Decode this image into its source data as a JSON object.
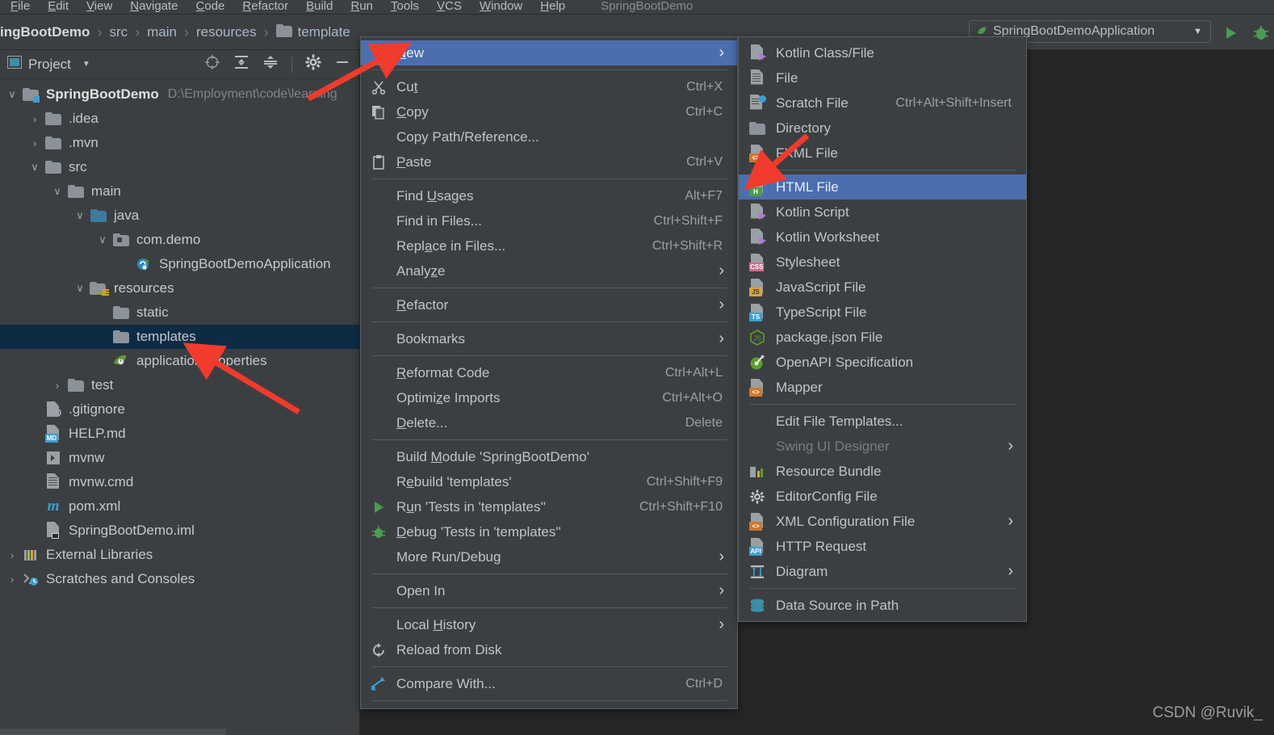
{
  "menubar": {
    "items": [
      "File",
      "Edit",
      "View",
      "Navigate",
      "Code",
      "Refactor",
      "Build",
      "Run",
      "Tools",
      "VCS",
      "Window",
      "Help"
    ],
    "project_name": "SpringBootDemo"
  },
  "toolbar": {
    "run_config_label": "SpringBootDemoApplication",
    "caret": "▼",
    "run_icon": "run-icon",
    "debug_icon": "debug-icon"
  },
  "breadcrumb": {
    "crumbs": [
      "ingBootDemo",
      "src",
      "main",
      "resources",
      "template"
    ],
    "separator": "›"
  },
  "toolwindow": {
    "title": "Project",
    "caret": "▼",
    "actions": [
      "locate-icon",
      "expand-all-icon",
      "collapse-all-icon",
      "gear-icon",
      "hide-icon"
    ]
  },
  "tree": [
    {
      "indent": 0,
      "arrow": "∨",
      "icon": "project-folder-icon",
      "label": "SpringBootDemo",
      "bold": true,
      "subtle": "D:\\Employment\\code\\learning",
      "selected": false
    },
    {
      "indent": 1,
      "arrow": "›",
      "icon": "folder-icon",
      "label": ".idea",
      "bold": false,
      "subtle": "",
      "selected": false
    },
    {
      "indent": 1,
      "arrow": "›",
      "icon": "folder-icon",
      "label": ".mvn",
      "bold": false,
      "subtle": "",
      "selected": false
    },
    {
      "indent": 1,
      "arrow": "∨",
      "icon": "folder-icon",
      "label": "src",
      "bold": false,
      "subtle": "",
      "selected": false
    },
    {
      "indent": 2,
      "arrow": "∨",
      "icon": "folder-icon",
      "label": "main",
      "bold": false,
      "subtle": "",
      "selected": false
    },
    {
      "indent": 3,
      "arrow": "∨",
      "icon": "source-folder-icon",
      "label": "java",
      "bold": false,
      "subtle": "",
      "selected": false
    },
    {
      "indent": 4,
      "arrow": "∨",
      "icon": "package-icon",
      "label": "com.demo",
      "bold": false,
      "subtle": "",
      "selected": false
    },
    {
      "indent": 5,
      "arrow": "",
      "icon": "spring-class-icon",
      "label": "SpringBootDemoApplication",
      "bold": false,
      "subtle": "",
      "selected": false
    },
    {
      "indent": 3,
      "arrow": "∨",
      "icon": "resources-folder-icon",
      "label": "resources",
      "bold": false,
      "subtle": "",
      "selected": false
    },
    {
      "indent": 4,
      "arrow": "",
      "icon": "folder-icon",
      "label": "static",
      "bold": false,
      "subtle": "",
      "selected": false
    },
    {
      "indent": 4,
      "arrow": "",
      "icon": "folder-icon",
      "label": "templates",
      "bold": false,
      "subtle": "",
      "selected": true
    },
    {
      "indent": 4,
      "arrow": "",
      "icon": "spring-properties-icon",
      "label": "application.properties",
      "bold": false,
      "subtle": "",
      "selected": false
    },
    {
      "indent": 2,
      "arrow": "›",
      "icon": "folder-icon",
      "label": "test",
      "bold": false,
      "subtle": "",
      "selected": false
    },
    {
      "indent": 1,
      "arrow": "",
      "icon": "gitignore-icon",
      "label": ".gitignore",
      "bold": false,
      "subtle": "",
      "selected": false
    },
    {
      "indent": 1,
      "arrow": "",
      "icon": "markdown-icon",
      "label": "HELP.md",
      "bold": false,
      "subtle": "",
      "selected": false
    },
    {
      "indent": 1,
      "arrow": "",
      "icon": "shell-script-icon",
      "label": "mvnw",
      "bold": false,
      "subtle": "",
      "selected": false
    },
    {
      "indent": 1,
      "arrow": "",
      "icon": "text-file-icon",
      "label": "mvnw.cmd",
      "bold": false,
      "subtle": "",
      "selected": false
    },
    {
      "indent": 1,
      "arrow": "",
      "icon": "maven-icon",
      "label": "pom.xml",
      "bold": false,
      "subtle": "",
      "selected": false
    },
    {
      "indent": 1,
      "arrow": "",
      "icon": "iml-module-icon",
      "label": "SpringBootDemo.iml",
      "bold": false,
      "subtle": "",
      "selected": false
    },
    {
      "indent": 0,
      "arrow": "›",
      "icon": "external-libraries-icon",
      "label": "External Libraries",
      "bold": false,
      "subtle": "",
      "selected": false
    },
    {
      "indent": 0,
      "arrow": "›",
      "icon": "scratches-icon",
      "label": "Scratches and Consoles",
      "bold": false,
      "subtle": "",
      "selected": false
    }
  ],
  "context_menu": [
    {
      "type": "item",
      "label": "New",
      "mnemonic": "N",
      "shortcut": "",
      "icon": "",
      "submenu": true,
      "highlight": true
    },
    {
      "type": "sep"
    },
    {
      "type": "item",
      "label": "Cut",
      "mnemonic": "t",
      "shortcut": "Ctrl+X",
      "icon": "cut-icon",
      "submenu": false
    },
    {
      "type": "item",
      "label": "Copy",
      "mnemonic": "C",
      "shortcut": "Ctrl+C",
      "icon": "copy-icon",
      "submenu": false
    },
    {
      "type": "item",
      "label": "Copy Path/Reference...",
      "shortcut": "",
      "icon": "",
      "submenu": false
    },
    {
      "type": "item",
      "label": "Paste",
      "mnemonic": "P",
      "shortcut": "Ctrl+V",
      "icon": "paste-icon",
      "submenu": false
    },
    {
      "type": "sep"
    },
    {
      "type": "item",
      "label": "Find Usages",
      "mnemonic": "U",
      "shortcut": "Alt+F7",
      "icon": "",
      "submenu": false
    },
    {
      "type": "item",
      "label": "Find in Files...",
      "shortcut": "Ctrl+Shift+F",
      "icon": "",
      "submenu": false
    },
    {
      "type": "item",
      "label": "Replace in Files...",
      "mnemonic": "a",
      "shortcut": "Ctrl+Shift+R",
      "icon": "",
      "submenu": false
    },
    {
      "type": "item",
      "label": "Analyze",
      "mnemonic": "z",
      "shortcut": "",
      "icon": "",
      "submenu": true
    },
    {
      "type": "sep"
    },
    {
      "type": "item",
      "label": "Refactor",
      "mnemonic": "R",
      "shortcut": "",
      "icon": "",
      "submenu": true
    },
    {
      "type": "sep"
    },
    {
      "type": "item",
      "label": "Bookmarks",
      "shortcut": "",
      "icon": "",
      "submenu": true
    },
    {
      "type": "sep"
    },
    {
      "type": "item",
      "label": "Reformat Code",
      "mnemonic": "R",
      "shortcut": "Ctrl+Alt+L",
      "icon": "",
      "submenu": false
    },
    {
      "type": "item",
      "label": "Optimize Imports",
      "mnemonic": "z",
      "shortcut": "Ctrl+Alt+O",
      "icon": "",
      "submenu": false
    },
    {
      "type": "item",
      "label": "Delete...",
      "mnemonic": "D",
      "shortcut": "Delete",
      "icon": "",
      "submenu": false
    },
    {
      "type": "sep"
    },
    {
      "type": "item",
      "label": "Build Module 'SpringBootDemo'",
      "mnemonic": "M",
      "shortcut": "",
      "icon": "",
      "submenu": false
    },
    {
      "type": "item",
      "label": "Rebuild 'templates'",
      "mnemonic": "e",
      "shortcut": "Ctrl+Shift+F9",
      "icon": "",
      "submenu": false
    },
    {
      "type": "item",
      "label": "Run 'Tests in 'templates''",
      "mnemonic": "u",
      "shortcut": "Ctrl+Shift+F10",
      "icon": "run-icon",
      "submenu": false
    },
    {
      "type": "item",
      "label": "Debug 'Tests in 'templates''",
      "mnemonic": "D",
      "shortcut": "",
      "icon": "debug-icon",
      "submenu": false
    },
    {
      "type": "item",
      "label": "More Run/Debug",
      "shortcut": "",
      "icon": "",
      "submenu": true
    },
    {
      "type": "sep"
    },
    {
      "type": "item",
      "label": "Open In",
      "shortcut": "",
      "icon": "",
      "submenu": true
    },
    {
      "type": "sep"
    },
    {
      "type": "item",
      "label": "Local History",
      "mnemonic": "H",
      "shortcut": "",
      "icon": "",
      "submenu": true
    },
    {
      "type": "item",
      "label": "Reload from Disk",
      "shortcut": "",
      "icon": "reload-icon",
      "submenu": false
    },
    {
      "type": "sep"
    },
    {
      "type": "item",
      "label": "Compare With...",
      "shortcut": "Ctrl+D",
      "icon": "compare-icon",
      "submenu": false
    },
    {
      "type": "sep"
    }
  ],
  "submenu": [
    {
      "type": "item",
      "label": "Kotlin Class/File",
      "shortcut": "",
      "icon": "kotlin-file-icon",
      "submenu": false
    },
    {
      "type": "item",
      "label": "File",
      "shortcut": "",
      "icon": "file-icon",
      "submenu": false
    },
    {
      "type": "item",
      "label": "Scratch File",
      "shortcut": "Ctrl+Alt+Shift+Insert",
      "icon": "scratch-file-icon",
      "submenu": false
    },
    {
      "type": "item",
      "label": "Directory",
      "shortcut": "",
      "icon": "directory-icon",
      "submenu": false
    },
    {
      "type": "item",
      "label": "FXML File",
      "shortcut": "",
      "icon": "fxml-file-icon",
      "submenu": false
    },
    {
      "type": "sep"
    },
    {
      "type": "item",
      "label": "HTML File",
      "shortcut": "",
      "icon": "html-file-icon",
      "submenu": false,
      "highlight": true
    },
    {
      "type": "item",
      "label": "Kotlin Script",
      "shortcut": "",
      "icon": "kotlin-script-icon",
      "submenu": false
    },
    {
      "type": "item",
      "label": "Kotlin Worksheet",
      "shortcut": "",
      "icon": "kotlin-worksheet-icon",
      "submenu": false
    },
    {
      "type": "item",
      "label": "Stylesheet",
      "shortcut": "",
      "icon": "css-file-icon",
      "submenu": false
    },
    {
      "type": "item",
      "label": "JavaScript File",
      "shortcut": "",
      "icon": "js-file-icon",
      "submenu": false
    },
    {
      "type": "item",
      "label": "TypeScript File",
      "shortcut": "",
      "icon": "ts-file-icon",
      "submenu": false
    },
    {
      "type": "item",
      "label": "package.json File",
      "shortcut": "",
      "icon": "nodejs-icon",
      "submenu": false
    },
    {
      "type": "item",
      "label": "OpenAPI Specification",
      "shortcut": "",
      "icon": "openapi-icon",
      "submenu": false
    },
    {
      "type": "item",
      "label": "Mapper",
      "shortcut": "",
      "icon": "mapper-icon",
      "submenu": false
    },
    {
      "type": "sep"
    },
    {
      "type": "item",
      "label": "Edit File Templates...",
      "shortcut": "",
      "icon": "",
      "submenu": false
    },
    {
      "type": "item",
      "label": "Swing UI Designer",
      "shortcut": "",
      "icon": "",
      "submenu": true,
      "disabled": true
    },
    {
      "type": "item",
      "label": "Resource Bundle",
      "shortcut": "",
      "icon": "resource-bundle-icon",
      "submenu": false
    },
    {
      "type": "item",
      "label": "EditorConfig File",
      "shortcut": "",
      "icon": "gear-icon",
      "submenu": false
    },
    {
      "type": "item",
      "label": "XML Configuration File",
      "shortcut": "",
      "icon": "xml-file-icon",
      "submenu": true
    },
    {
      "type": "item",
      "label": "HTTP Request",
      "shortcut": "",
      "icon": "http-request-icon",
      "submenu": false
    },
    {
      "type": "item",
      "label": "Diagram",
      "shortcut": "",
      "icon": "diagram-icon",
      "submenu": true
    },
    {
      "type": "sep"
    },
    {
      "type": "item",
      "label": "Data Source in Path",
      "shortcut": "",
      "icon": "datasource-icon",
      "submenu": false
    }
  ],
  "watermark": "CSDN @Ruvik_",
  "colors": {
    "panel": "#3c3f41",
    "editor_bg": "#262626",
    "menu_highlight": "#4b6eaf",
    "tree_selection": "#0d2b45",
    "text": "#bfc4c8",
    "accent_green": "#499c54",
    "annotation_red": "#f03b2d"
  }
}
